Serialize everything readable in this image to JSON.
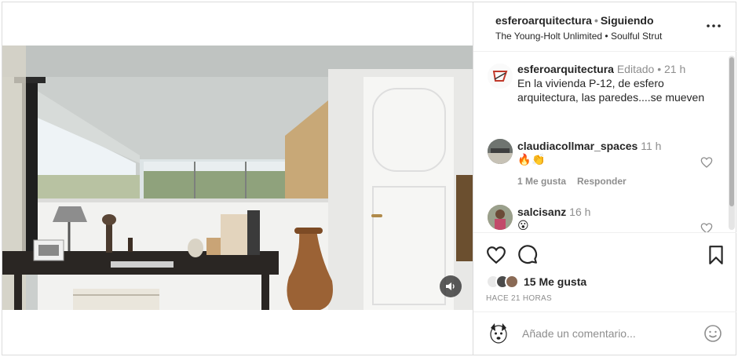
{
  "post": {
    "media": {
      "type": "video",
      "mute_icon": "speaker-icon"
    },
    "header": {
      "username": "esferoarquitectura",
      "separator": "•",
      "follow_status": "Siguiendo",
      "audio_artist": "The Young-Holt Unlimited",
      "audio_separator": "•",
      "audio_title": "Soulful Strut",
      "more_icon": "more-options-icon"
    },
    "caption": {
      "username": "esferoarquitectura",
      "edited_label": "Editado",
      "separator": "•",
      "time": "21 h",
      "text": "En la vivienda P-12, de esfero arquitectura, las paredes....se mueven"
    },
    "comments": [
      {
        "username": "claudiacollmar_spaces",
        "time": "11 h",
        "text": "🔥👏",
        "likes_label": "1 Me gusta",
        "reply_label": "Responder"
      },
      {
        "username": "salcisanz",
        "time": "16 h",
        "text": "😮"
      }
    ],
    "actions": {
      "like_icon": "heart-icon",
      "comment_icon": "comment-icon",
      "save_icon": "bookmark-icon"
    },
    "likes_label": "15 Me gusta",
    "timestamp": "HACE 21 HORAS",
    "add_comment": {
      "placeholder": "Añade un comentario...",
      "emoji_icon": "smiley-icon"
    }
  },
  "colors": {
    "text": "#262626",
    "muted": "#8e8e8e",
    "border": "#dbdbdb"
  }
}
